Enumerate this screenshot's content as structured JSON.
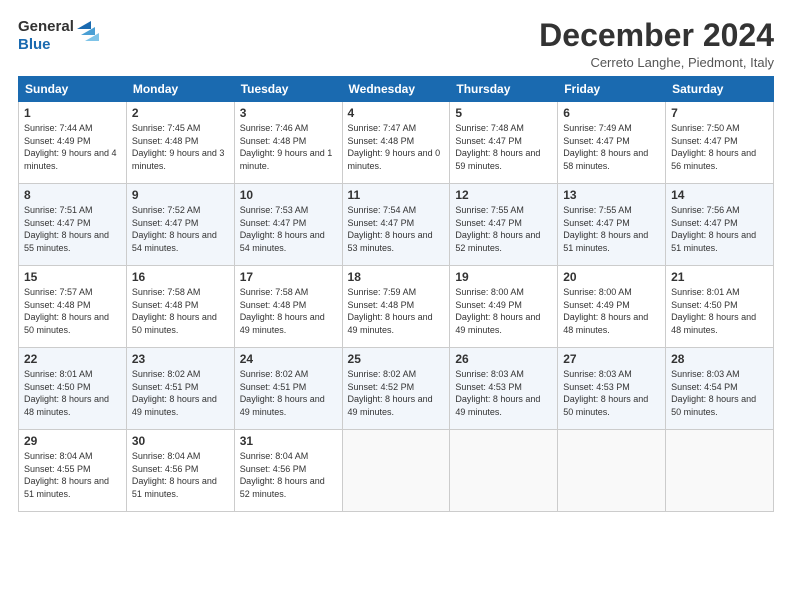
{
  "header": {
    "logo_line1": "General",
    "logo_line2": "Blue",
    "month": "December 2024",
    "location": "Cerreto Langhe, Piedmont, Italy"
  },
  "weekdays": [
    "Sunday",
    "Monday",
    "Tuesday",
    "Wednesday",
    "Thursday",
    "Friday",
    "Saturday"
  ],
  "weeks": [
    [
      {
        "day": "1",
        "sunrise": "7:44 AM",
        "sunset": "4:49 PM",
        "daylight": "9 hours and 4 minutes."
      },
      {
        "day": "2",
        "sunrise": "7:45 AM",
        "sunset": "4:48 PM",
        "daylight": "9 hours and 3 minutes."
      },
      {
        "day": "3",
        "sunrise": "7:46 AM",
        "sunset": "4:48 PM",
        "daylight": "9 hours and 1 minute."
      },
      {
        "day": "4",
        "sunrise": "7:47 AM",
        "sunset": "4:48 PM",
        "daylight": "9 hours and 0 minutes."
      },
      {
        "day": "5",
        "sunrise": "7:48 AM",
        "sunset": "4:47 PM",
        "daylight": "8 hours and 59 minutes."
      },
      {
        "day": "6",
        "sunrise": "7:49 AM",
        "sunset": "4:47 PM",
        "daylight": "8 hours and 58 minutes."
      },
      {
        "day": "7",
        "sunrise": "7:50 AM",
        "sunset": "4:47 PM",
        "daylight": "8 hours and 56 minutes."
      }
    ],
    [
      {
        "day": "8",
        "sunrise": "7:51 AM",
        "sunset": "4:47 PM",
        "daylight": "8 hours and 55 minutes."
      },
      {
        "day": "9",
        "sunrise": "7:52 AM",
        "sunset": "4:47 PM",
        "daylight": "8 hours and 54 minutes."
      },
      {
        "day": "10",
        "sunrise": "7:53 AM",
        "sunset": "4:47 PM",
        "daylight": "8 hours and 54 minutes."
      },
      {
        "day": "11",
        "sunrise": "7:54 AM",
        "sunset": "4:47 PM",
        "daylight": "8 hours and 53 minutes."
      },
      {
        "day": "12",
        "sunrise": "7:55 AM",
        "sunset": "4:47 PM",
        "daylight": "8 hours and 52 minutes."
      },
      {
        "day": "13",
        "sunrise": "7:55 AM",
        "sunset": "4:47 PM",
        "daylight": "8 hours and 51 minutes."
      },
      {
        "day": "14",
        "sunrise": "7:56 AM",
        "sunset": "4:47 PM",
        "daylight": "8 hours and 51 minutes."
      }
    ],
    [
      {
        "day": "15",
        "sunrise": "7:57 AM",
        "sunset": "4:48 PM",
        "daylight": "8 hours and 50 minutes."
      },
      {
        "day": "16",
        "sunrise": "7:58 AM",
        "sunset": "4:48 PM",
        "daylight": "8 hours and 50 minutes."
      },
      {
        "day": "17",
        "sunrise": "7:58 AM",
        "sunset": "4:48 PM",
        "daylight": "8 hours and 49 minutes."
      },
      {
        "day": "18",
        "sunrise": "7:59 AM",
        "sunset": "4:48 PM",
        "daylight": "8 hours and 49 minutes."
      },
      {
        "day": "19",
        "sunrise": "8:00 AM",
        "sunset": "4:49 PM",
        "daylight": "8 hours and 49 minutes."
      },
      {
        "day": "20",
        "sunrise": "8:00 AM",
        "sunset": "4:49 PM",
        "daylight": "8 hours and 48 minutes."
      },
      {
        "day": "21",
        "sunrise": "8:01 AM",
        "sunset": "4:50 PM",
        "daylight": "8 hours and 48 minutes."
      }
    ],
    [
      {
        "day": "22",
        "sunrise": "8:01 AM",
        "sunset": "4:50 PM",
        "daylight": "8 hours and 48 minutes."
      },
      {
        "day": "23",
        "sunrise": "8:02 AM",
        "sunset": "4:51 PM",
        "daylight": "8 hours and 49 minutes."
      },
      {
        "day": "24",
        "sunrise": "8:02 AM",
        "sunset": "4:51 PM",
        "daylight": "8 hours and 49 minutes."
      },
      {
        "day": "25",
        "sunrise": "8:02 AM",
        "sunset": "4:52 PM",
        "daylight": "8 hours and 49 minutes."
      },
      {
        "day": "26",
        "sunrise": "8:03 AM",
        "sunset": "4:53 PM",
        "daylight": "8 hours and 49 minutes."
      },
      {
        "day": "27",
        "sunrise": "8:03 AM",
        "sunset": "4:53 PM",
        "daylight": "8 hours and 50 minutes."
      },
      {
        "day": "28",
        "sunrise": "8:03 AM",
        "sunset": "4:54 PM",
        "daylight": "8 hours and 50 minutes."
      }
    ],
    [
      {
        "day": "29",
        "sunrise": "8:04 AM",
        "sunset": "4:55 PM",
        "daylight": "8 hours and 51 minutes."
      },
      {
        "day": "30",
        "sunrise": "8:04 AM",
        "sunset": "4:56 PM",
        "daylight": "8 hours and 51 minutes."
      },
      {
        "day": "31",
        "sunrise": "8:04 AM",
        "sunset": "4:56 PM",
        "daylight": "8 hours and 52 minutes."
      },
      null,
      null,
      null,
      null
    ]
  ]
}
